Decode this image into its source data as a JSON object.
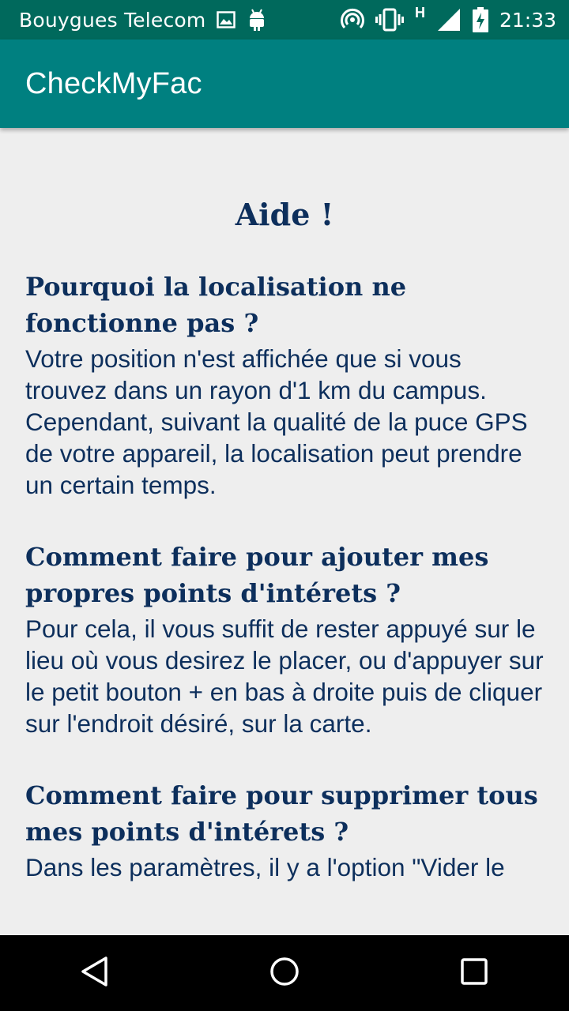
{
  "status_bar": {
    "carrier": "Bouygues Telecom",
    "network_type": "H",
    "time": "21:33",
    "icons": [
      "image-icon",
      "android-icon",
      "hotspot-icon",
      "vibrate-icon",
      "signal-icon",
      "battery-charging-icon"
    ]
  },
  "app_bar": {
    "title": "CheckMyFac",
    "color": "#008080"
  },
  "help": {
    "title": "Aide !",
    "sections": [
      {
        "question": "Pourquoi la localisation ne fonctionne pas ?",
        "answer": "Votre position n'est affichée que si vous trouvez dans un rayon d'1 km du campus. Cependant, suivant la qualité de la puce GPS de votre appareil, la localisation peut prendre un certain temps."
      },
      {
        "question": "Comment faire pour ajouter mes propres points d'intérets ?",
        "answer": "Pour cela, il vous suffit de rester appuyé sur le lieu où vous desirez le placer, ou d'appuyer sur le petit bouton + en bas à droite puis de cliquer sur l'endroit désiré, sur la carte."
      },
      {
        "question": "Comment faire pour supprimer tous mes points d'intérets ?",
        "answer": "Dans les paramètres, il y a l'option \"Vider le"
      }
    ]
  },
  "nav_bar": {
    "buttons": [
      "back-icon",
      "home-icon",
      "recents-icon"
    ]
  }
}
